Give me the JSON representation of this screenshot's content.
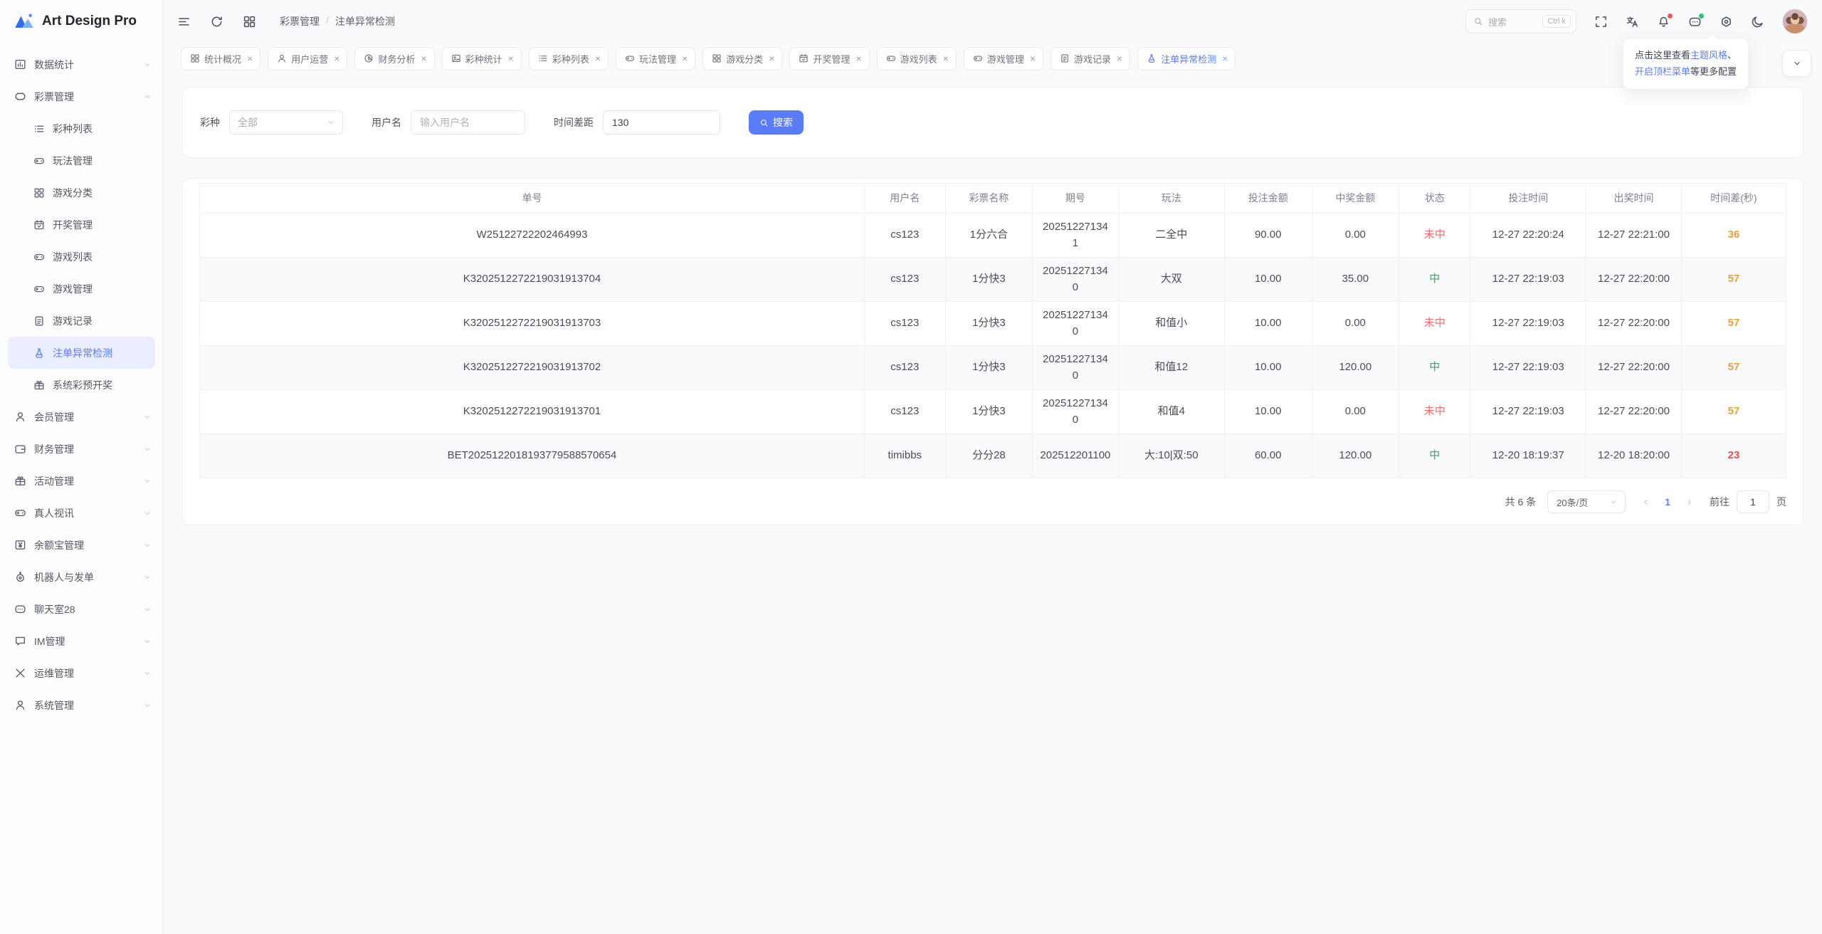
{
  "app": {
    "logo_title": "Art Design Pro"
  },
  "colors": {
    "accent": "#5A7CF8",
    "success": "#3CA45F",
    "danger": "#F56C6C",
    "warning": "#E6A23C",
    "diff_danger": "#E5504D",
    "sidebar_active_bg": "#E9EDFD"
  },
  "sidebar": {
    "items": [
      {
        "icon": "chart-icon",
        "label": "数据统计",
        "expandable": true,
        "expanded": false
      },
      {
        "icon": "ticket-icon",
        "label": "彩票管理",
        "expandable": true,
        "expanded": true,
        "children": [
          {
            "icon": "list-icon",
            "label": "彩种列表"
          },
          {
            "icon": "gamepad-icon",
            "label": "玩法管理"
          },
          {
            "icon": "grid-icon",
            "label": "游戏分类"
          },
          {
            "icon": "calendar-icon",
            "label": "开奖管理"
          },
          {
            "icon": "gamepad-icon",
            "label": "游戏列表"
          },
          {
            "icon": "gamepad-icon",
            "label": "游戏管理"
          },
          {
            "icon": "doc-icon",
            "label": "游戏记录"
          },
          {
            "icon": "flask-icon",
            "label": "注单异常检测",
            "active": true
          },
          {
            "icon": "gift-icon",
            "label": "系统彩预开奖"
          }
        ]
      },
      {
        "icon": "user-icon",
        "label": "会员管理",
        "expandable": true
      },
      {
        "icon": "wallet-icon",
        "label": "财务管理",
        "expandable": true
      },
      {
        "icon": "gift-icon",
        "label": "活动管理",
        "expandable": true
      },
      {
        "icon": "gamepad-icon",
        "label": "真人视讯",
        "expandable": true
      },
      {
        "icon": "money-icon",
        "label": "余额宝管理",
        "expandable": true
      },
      {
        "icon": "robot-icon",
        "label": "机器人与发单",
        "expandable": true
      },
      {
        "icon": "chat-icon",
        "label": "聊天室28",
        "expandable": true
      },
      {
        "icon": "message-icon",
        "label": "IM管理",
        "expandable": true
      },
      {
        "icon": "tools-icon",
        "label": "运维管理",
        "expandable": true
      },
      {
        "icon": "user-icon",
        "label": "系统管理",
        "expandable": true
      }
    ]
  },
  "header": {
    "breadcrumb": [
      "彩票管理",
      "注单异常检测"
    ],
    "search_placeholder": "搜索",
    "search_shortcut": "Ctrl k"
  },
  "tabs": [
    {
      "icon": "grid-icon",
      "label": "统计概况"
    },
    {
      "icon": "user-icon",
      "label": "用户运营"
    },
    {
      "icon": "finance-icon",
      "label": "财务分析"
    },
    {
      "icon": "image-icon",
      "label": "彩种统计"
    },
    {
      "icon": "list-icon",
      "label": "彩种列表"
    },
    {
      "icon": "gamepad-icon",
      "label": "玩法管理"
    },
    {
      "icon": "grid-icon",
      "label": "游戏分类"
    },
    {
      "icon": "calendar-icon",
      "label": "开奖管理"
    },
    {
      "icon": "gamepad-icon",
      "label": "游戏列表"
    },
    {
      "icon": "gamepad-icon",
      "label": "游戏管理"
    },
    {
      "icon": "doc-icon",
      "label": "游戏记录"
    },
    {
      "icon": "flask-icon",
      "label": "注单异常检测",
      "active": true
    }
  ],
  "tooltip": {
    "line1_prefix": "点击这里查看",
    "line1_link": "主题风格",
    "line1_tail": "、",
    "line2_link": "开启顶栏菜单",
    "line2_tail": "等更多配置"
  },
  "filters": {
    "lottery_label": "彩种",
    "lottery_value": "全部",
    "username_label": "用户名",
    "username_placeholder": "输入用户名",
    "timediff_label": "时间差距",
    "timediff_value": "130",
    "search_button": "搜索"
  },
  "table": {
    "columns": [
      {
        "label": "单号",
        "width": "41.9%"
      },
      {
        "label": "用户名",
        "width": "5.1%"
      },
      {
        "label": "彩票名称",
        "width": "5.5%"
      },
      {
        "label": "期号",
        "width": "5.4%"
      },
      {
        "label": "玩法",
        "width": "6.7%"
      },
      {
        "label": "投注金额",
        "width": "5.5%"
      },
      {
        "label": "中奖金额",
        "width": "5.5%"
      },
      {
        "label": "状态",
        "width": "4.5%"
      },
      {
        "label": "投注时间",
        "width": "7.3%"
      },
      {
        "label": "出奖时间",
        "width": "6.0%"
      },
      {
        "label": "时间差(秒)",
        "width": "6.6%"
      }
    ],
    "rows": [
      {
        "order": "W25122722202464993",
        "username": "cs123",
        "lottery": "1分六合",
        "period": "202512271341",
        "play": "二全中",
        "bet": "90.00",
        "win": "0.00",
        "status": "未中",
        "status_type": "lose",
        "bet_time": "12-27 22:20:24",
        "draw_time": "12-27 22:21:00",
        "diff": "36",
        "diff_level": "warn"
      },
      {
        "order": "K3202512272219031913704",
        "username": "cs123",
        "lottery": "1分快3",
        "period": "202512271340",
        "play": "大双",
        "bet": "10.00",
        "win": "35.00",
        "status": "中",
        "status_type": "win",
        "bet_time": "12-27 22:19:03",
        "draw_time": "12-27 22:20:00",
        "diff": "57",
        "diff_level": "warn"
      },
      {
        "order": "K3202512272219031913703",
        "username": "cs123",
        "lottery": "1分快3",
        "period": "202512271340",
        "play": "和值小",
        "bet": "10.00",
        "win": "0.00",
        "status": "未中",
        "status_type": "lose",
        "bet_time": "12-27 22:19:03",
        "draw_time": "12-27 22:20:00",
        "diff": "57",
        "diff_level": "warn"
      },
      {
        "order": "K3202512272219031913702",
        "username": "cs123",
        "lottery": "1分快3",
        "period": "202512271340",
        "play": "和值12",
        "bet": "10.00",
        "win": "120.00",
        "status": "中",
        "status_type": "win",
        "bet_time": "12-27 22:19:03",
        "draw_time": "12-27 22:20:00",
        "diff": "57",
        "diff_level": "warn"
      },
      {
        "order": "K3202512272219031913701",
        "username": "cs123",
        "lottery": "1分快3",
        "period": "202512271340",
        "play": "和值4",
        "bet": "10.00",
        "win": "0.00",
        "status": "未中",
        "status_type": "lose",
        "bet_time": "12-27 22:19:03",
        "draw_time": "12-27 22:20:00",
        "diff": "57",
        "diff_level": "warn"
      },
      {
        "order": "BET2025122018193779588570654",
        "username": "timibbs",
        "lottery": "分分28",
        "period": "202512201100",
        "play": "大:10|双:50",
        "bet": "60.00",
        "win": "120.00",
        "status": "中",
        "status_type": "win",
        "bet_time": "12-20 18:19:37",
        "draw_time": "12-20 18:20:00",
        "diff": "23",
        "diff_level": "danger"
      }
    ]
  },
  "pagination": {
    "total_text": "共 6 条",
    "page_size": "20条/页",
    "current_page": "1",
    "goto_label": "前往",
    "goto_value": "1",
    "goto_suffix": "页"
  }
}
